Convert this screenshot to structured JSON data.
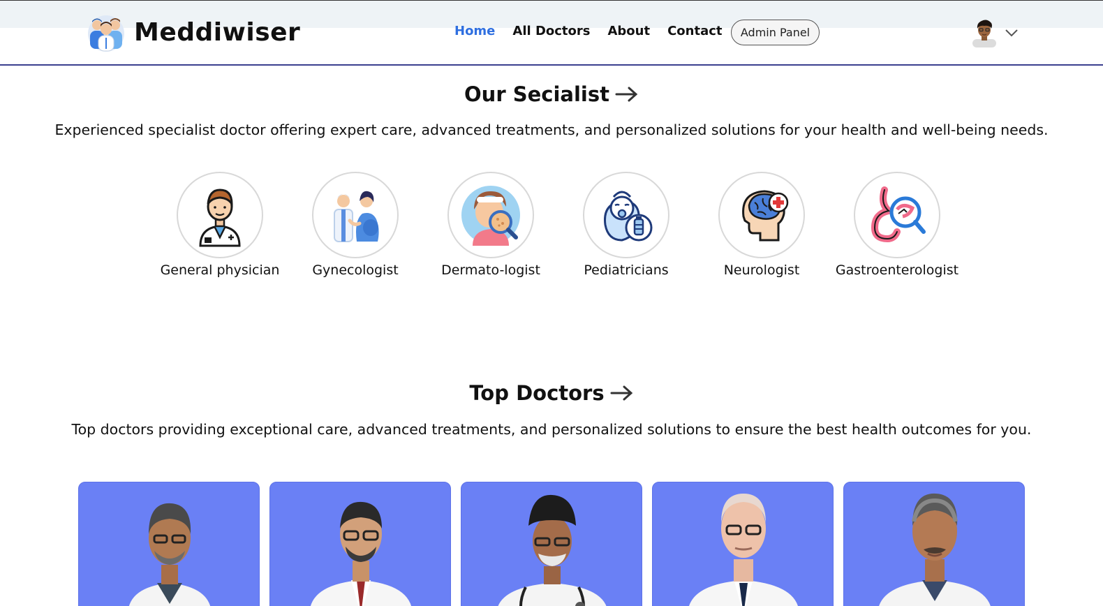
{
  "brand": {
    "name": "Meddiwiser",
    "logo_icon": "doctors-group-logo-icon"
  },
  "nav": {
    "links": [
      {
        "label": "Home",
        "active": true
      },
      {
        "label": "All Doctors",
        "active": false
      },
      {
        "label": "About",
        "active": false
      },
      {
        "label": "Contact",
        "active": false
      }
    ],
    "admin_button": "Admin Panel",
    "profile": {
      "avatar_icon": "user-avatar-icon",
      "dropdown_icon": "chevron-down-icon"
    }
  },
  "specialists": {
    "title": "Our Secialist",
    "description": "Experienced specialist doctor offering expert care, advanced treatments, and personalized solutions for your health and well-being needs.",
    "items": [
      {
        "label": "General physician",
        "icon": "physician-icon"
      },
      {
        "label": "Gynecologist",
        "icon": "gynecologist-icon"
      },
      {
        "label": "Dermato-logist",
        "icon": "dermatologist-icon"
      },
      {
        "label": "Pediatricians",
        "icon": "pediatrician-icon"
      },
      {
        "label": "Neurologist",
        "icon": "neurologist-icon"
      },
      {
        "label": "Gastroenterologist",
        "icon": "gastroenterologist-icon"
      }
    ]
  },
  "top_doctors": {
    "title": "Top Doctors",
    "description": "Top doctors providing exceptional care, advanced treatments, and personalized solutions to ensure the best health outcomes for you.",
    "cards": [
      {
        "image": "doctor-photo-1"
      },
      {
        "image": "doctor-photo-2"
      },
      {
        "image": "doctor-photo-3"
      },
      {
        "image": "doctor-photo-4"
      },
      {
        "image": "doctor-photo-5"
      }
    ]
  },
  "colors": {
    "accent": "#2f6fe0",
    "card_bg": "#6a80f5",
    "nav_border": "#3b3f8f"
  }
}
